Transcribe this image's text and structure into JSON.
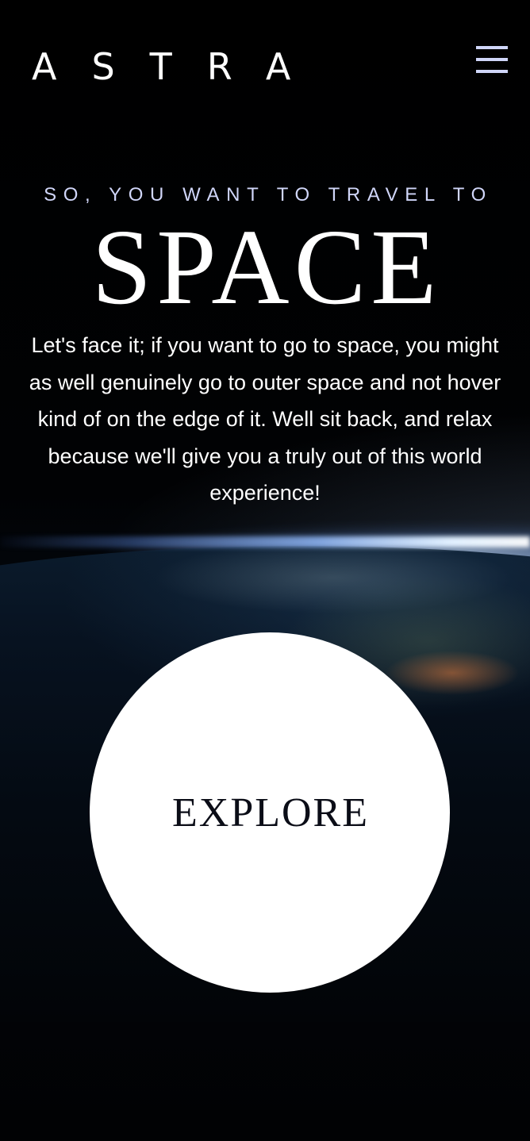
{
  "header": {
    "logo": "ASTRA",
    "menu_icon": "hamburger-menu-icon"
  },
  "hero": {
    "eyebrow": "SO, YOU WANT TO TRAVEL TO",
    "headline": "SPACE",
    "body": "Let's face it; if you want to go to space, you might as well genuinely go to outer space and not hover kind of on the edge of it. Well sit back, and relax because we'll give you a truly out of this world experience!"
  },
  "cta": {
    "label": "EXPLORE"
  },
  "colors": {
    "background": "#0b0d17",
    "accent": "#d0d6f9",
    "text": "#ffffff",
    "button": "#ffffff",
    "button_text": "#0b0d17"
  }
}
